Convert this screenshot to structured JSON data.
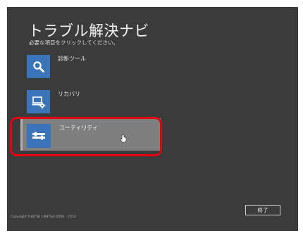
{
  "header": {
    "title": "トラブル解決ナビ",
    "subtitle": "必要な項目をクリックしてください。"
  },
  "menu": {
    "items": [
      {
        "label": "診断ツール",
        "icon": "magnifier-icon"
      },
      {
        "label": "リカバリ",
        "icon": "computer-gear-icon"
      },
      {
        "label": "ユーティリティ",
        "icon": "tools-icon"
      }
    ]
  },
  "footer": {
    "copyright": "Copyright FUJITSU LIMITED 2006 - 2012",
    "exit_label": "終了"
  },
  "colors": {
    "background": "#3b3b3b",
    "tile": "#3b74b8",
    "highlight": "#e60012"
  }
}
